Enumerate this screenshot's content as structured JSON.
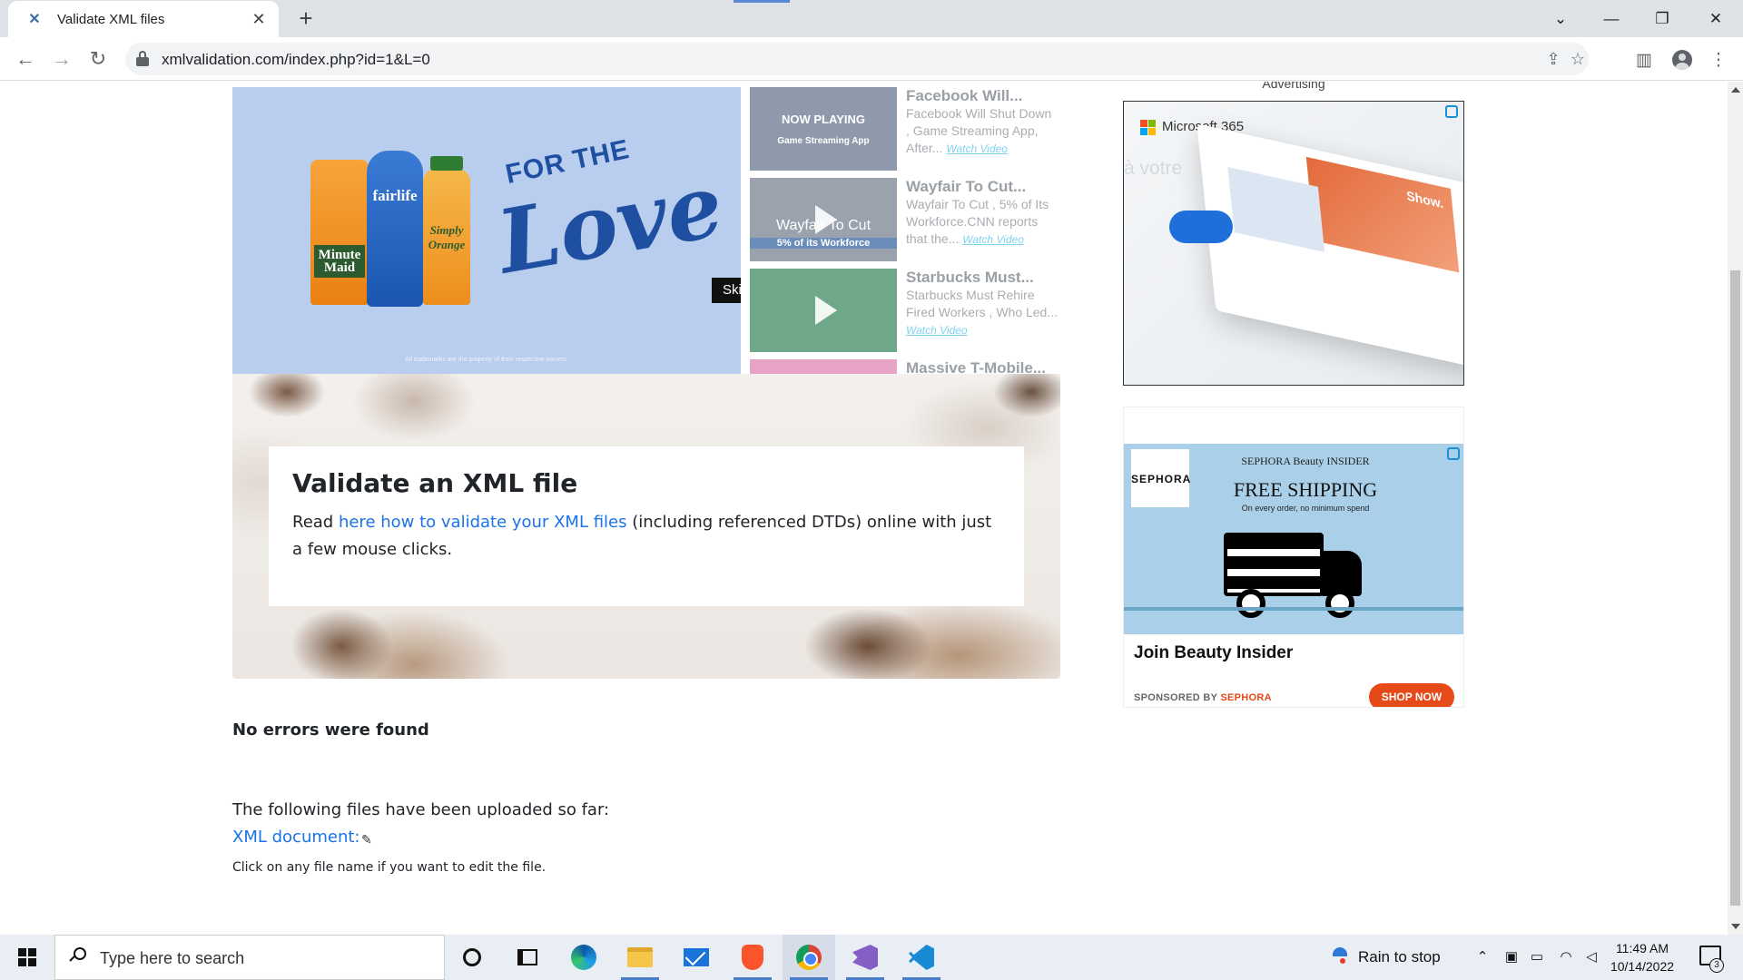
{
  "browser": {
    "tab_title": "Validate XML files",
    "tab_close": "✕",
    "new_tab": "+",
    "url": "xmlvalidation.com/index.php?id=1&L=0",
    "window_controls": {
      "minimize": "—",
      "restore": "❐",
      "close": "✕",
      "tab_search": "⌄"
    },
    "nav": {
      "back": "←",
      "forward": "→",
      "reload": "↻"
    },
    "toolbar_icons": [
      "share-icon",
      "bookmark-star-icon",
      "side-panel-icon",
      "profile-avatar-icon",
      "kebab-menu-icon"
    ]
  },
  "video_ad": {
    "products": [
      "Minute Maid",
      "fairlife",
      "Simply Orange"
    ],
    "slogan_top": "FOR THE",
    "slogan_main": "Love",
    "trademark": "All trademarks are the property of their respective owners.",
    "skip_label": "Ski"
  },
  "video_list": [
    {
      "title": "Facebook Will...",
      "desc": "Facebook Will Shut Down , Game Streaming App, After...",
      "watch": "Watch Video",
      "thumb_text": "NOW PLAYING",
      "thumb_sub": "Game Streaming App",
      "thumb_color": "#8e9aab"
    },
    {
      "title": "Wayfair To Cut...",
      "desc": "Wayfair To Cut , 5% of Its Workforce.CNN reports that the...",
      "watch": "Watch Video",
      "thumb_text": "Wayfair To Cut",
      "thumb_sub": "5% of its Workforce",
      "thumb_color": "#9aa3ad"
    },
    {
      "title": "Starbucks Must...",
      "desc": "Starbucks Must Rehire Fired Workers , Who Led...",
      "watch": "Watch Video",
      "thumb_text": "",
      "thumb_sub": "",
      "thumb_color": "#6fa889"
    },
    {
      "title": "Massive T-Mobile...",
      "desc": "",
      "watch": "",
      "thumb_text": "",
      "thumb_sub": "",
      "thumb_color": "#e7a3c6"
    }
  ],
  "hero": {
    "title": "Validate an XML file",
    "text_before": "Read ",
    "link_text": "here how to validate your XML files",
    "text_after": " (including referenced DTDs) online with just a few mouse clicks."
  },
  "result": {
    "status": "No errors were found",
    "uploaded_label": "The following files have been uploaded so far:",
    "file_link": "XML document:",
    "hint": "Click on any file name if you want to edit the file."
  },
  "ads": {
    "label": "Advertising",
    "ms365": {
      "brand": "Microsoft 365",
      "faded_text": "à votre",
      "ppt_text": "Show."
    },
    "sephora": {
      "logo": "SEPHORA",
      "beauty_insider": "SEPHORA Beauty INSIDER",
      "headline_image": "FREE SHIPPING",
      "sub": "On every order, no minimum spend",
      "headline": "Join Beauty Insider",
      "sponsored_prefix": "SPONSORED BY ",
      "sponsored_brand": "SEPHORA",
      "cta": "SHOP NOW"
    }
  },
  "taskbar": {
    "search_placeholder": "Type here to search",
    "apps": [
      "cortana-icon",
      "task-view-icon",
      "edge-icon",
      "file-explorer-icon",
      "mail-icon",
      "brave-icon",
      "chrome-icon",
      "visual-studio-icon",
      "vscode-icon"
    ],
    "weather": "Rain to stop",
    "time": "11:49 AM",
    "date": "10/14/2022",
    "notification_count": "3"
  }
}
